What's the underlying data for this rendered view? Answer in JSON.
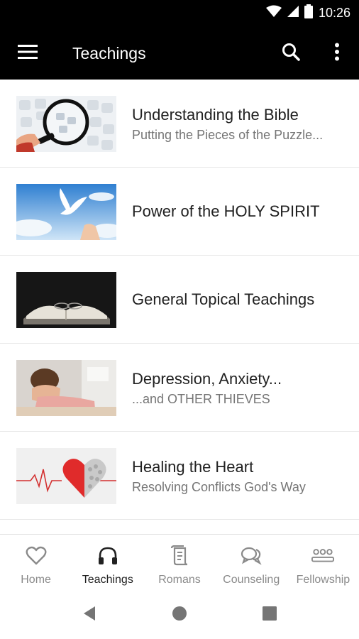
{
  "status_bar": {
    "time": "10:26"
  },
  "app_bar": {
    "title": "Teachings"
  },
  "items": [
    {
      "title": "Understanding the Bible",
      "subtitle": "Putting the Pieces of the Puzzle..."
    },
    {
      "title": "Power of the HOLY SPIRIT",
      "subtitle": ""
    },
    {
      "title": "General Topical Teachings",
      "subtitle": ""
    },
    {
      "title": "Depression, Anxiety...",
      "subtitle": "...and OTHER THIEVES"
    },
    {
      "title": "Healing the Heart",
      "subtitle": "Resolving Conflicts God's Way"
    }
  ],
  "bottom_nav": [
    {
      "label": "Home",
      "icon": "heart-icon",
      "active": false
    },
    {
      "label": "Teachings",
      "icon": "headphones-icon",
      "active": true
    },
    {
      "label": "Romans",
      "icon": "scroll-icon",
      "active": false
    },
    {
      "label": "Counseling",
      "icon": "chat-bubbles-icon",
      "active": false
    },
    {
      "label": "Fellowship",
      "icon": "people-icon",
      "active": false
    }
  ],
  "colors": {
    "app_bar": "#000000",
    "active_nav": "#212121",
    "inactive_nav": "#8a8a8a",
    "divider": "#e6e6e6"
  }
}
